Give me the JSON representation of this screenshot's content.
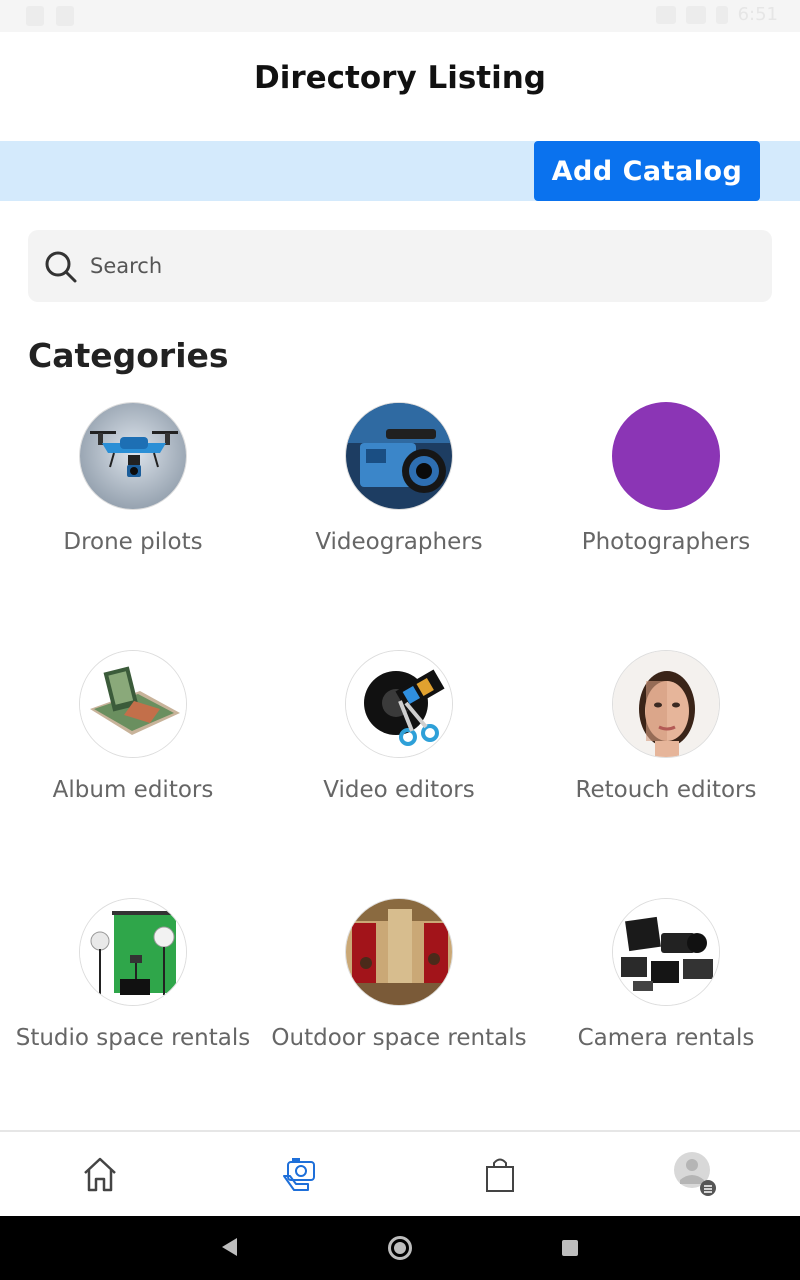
{
  "status_bar": {
    "time": "6:51"
  },
  "header": {
    "title": "Directory Listing"
  },
  "catalog": {
    "add_label": "Add Catalog"
  },
  "search": {
    "placeholder": "Search",
    "value": ""
  },
  "categories": {
    "title": "Categories",
    "items": [
      {
        "label": "Drone pilots",
        "icon": "drone-image"
      },
      {
        "label": "Videographers",
        "icon": "video-camera-image"
      },
      {
        "label": "Photographers",
        "icon": "purple-placeholder-image"
      },
      {
        "label": "Album editors",
        "icon": "photo-album-image"
      },
      {
        "label": "Video editors",
        "icon": "film-reel-scissors-image"
      },
      {
        "label": "Retouch editors",
        "icon": "retouched-face-image"
      },
      {
        "label": "Studio space rentals",
        "icon": "green-screen-studio-image"
      },
      {
        "label": "Outdoor space rentals",
        "icon": "outdoor-set-image"
      },
      {
        "label": "Camera rentals",
        "icon": "camera-gear-image"
      }
    ]
  },
  "bottom_nav": {
    "items": [
      {
        "icon": "home-icon"
      },
      {
        "icon": "camera-hand-icon"
      },
      {
        "icon": "shopping-bag-icon"
      },
      {
        "icon": "profile-avatar-icon"
      }
    ]
  },
  "colors": {
    "accent": "#0a72ee",
    "catalog_bar": "#d4eafc",
    "active_nav": "#1e6fd9",
    "photographers_tile": "#8b35b5"
  }
}
